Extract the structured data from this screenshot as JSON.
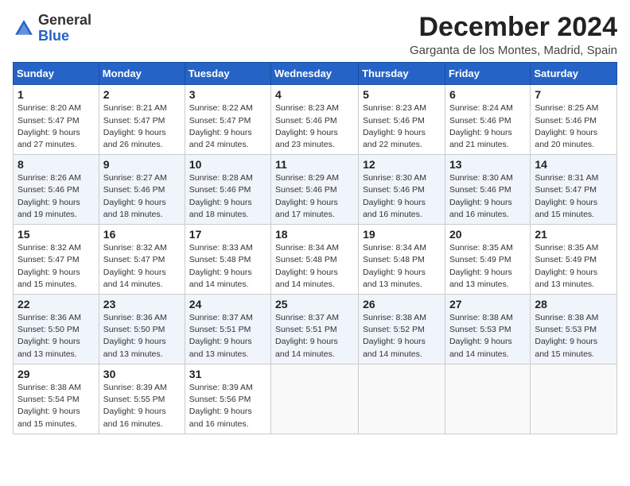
{
  "header": {
    "logo_general": "General",
    "logo_blue": "Blue",
    "month_title": "December 2024",
    "location": "Garganta de los Montes, Madrid, Spain"
  },
  "days_of_week": [
    "Sunday",
    "Monday",
    "Tuesday",
    "Wednesday",
    "Thursday",
    "Friday",
    "Saturday"
  ],
  "weeks": [
    [
      {
        "day": "1",
        "info": "Sunrise: 8:20 AM\nSunset: 5:47 PM\nDaylight: 9 hours and 27 minutes."
      },
      {
        "day": "2",
        "info": "Sunrise: 8:21 AM\nSunset: 5:47 PM\nDaylight: 9 hours and 26 minutes."
      },
      {
        "day": "3",
        "info": "Sunrise: 8:22 AM\nSunset: 5:47 PM\nDaylight: 9 hours and 24 minutes."
      },
      {
        "day": "4",
        "info": "Sunrise: 8:23 AM\nSunset: 5:46 PM\nDaylight: 9 hours and 23 minutes."
      },
      {
        "day": "5",
        "info": "Sunrise: 8:23 AM\nSunset: 5:46 PM\nDaylight: 9 hours and 22 minutes."
      },
      {
        "day": "6",
        "info": "Sunrise: 8:24 AM\nSunset: 5:46 PM\nDaylight: 9 hours and 21 minutes."
      },
      {
        "day": "7",
        "info": "Sunrise: 8:25 AM\nSunset: 5:46 PM\nDaylight: 9 hours and 20 minutes."
      }
    ],
    [
      {
        "day": "8",
        "info": "Sunrise: 8:26 AM\nSunset: 5:46 PM\nDaylight: 9 hours and 19 minutes."
      },
      {
        "day": "9",
        "info": "Sunrise: 8:27 AM\nSunset: 5:46 PM\nDaylight: 9 hours and 18 minutes."
      },
      {
        "day": "10",
        "info": "Sunrise: 8:28 AM\nSunset: 5:46 PM\nDaylight: 9 hours and 18 minutes."
      },
      {
        "day": "11",
        "info": "Sunrise: 8:29 AM\nSunset: 5:46 PM\nDaylight: 9 hours and 17 minutes."
      },
      {
        "day": "12",
        "info": "Sunrise: 8:30 AM\nSunset: 5:46 PM\nDaylight: 9 hours and 16 minutes."
      },
      {
        "day": "13",
        "info": "Sunrise: 8:30 AM\nSunset: 5:46 PM\nDaylight: 9 hours and 16 minutes."
      },
      {
        "day": "14",
        "info": "Sunrise: 8:31 AM\nSunset: 5:47 PM\nDaylight: 9 hours and 15 minutes."
      }
    ],
    [
      {
        "day": "15",
        "info": "Sunrise: 8:32 AM\nSunset: 5:47 PM\nDaylight: 9 hours and 15 minutes."
      },
      {
        "day": "16",
        "info": "Sunrise: 8:32 AM\nSunset: 5:47 PM\nDaylight: 9 hours and 14 minutes."
      },
      {
        "day": "17",
        "info": "Sunrise: 8:33 AM\nSunset: 5:48 PM\nDaylight: 9 hours and 14 minutes."
      },
      {
        "day": "18",
        "info": "Sunrise: 8:34 AM\nSunset: 5:48 PM\nDaylight: 9 hours and 14 minutes."
      },
      {
        "day": "19",
        "info": "Sunrise: 8:34 AM\nSunset: 5:48 PM\nDaylight: 9 hours and 13 minutes."
      },
      {
        "day": "20",
        "info": "Sunrise: 8:35 AM\nSunset: 5:49 PM\nDaylight: 9 hours and 13 minutes."
      },
      {
        "day": "21",
        "info": "Sunrise: 8:35 AM\nSunset: 5:49 PM\nDaylight: 9 hours and 13 minutes."
      }
    ],
    [
      {
        "day": "22",
        "info": "Sunrise: 8:36 AM\nSunset: 5:50 PM\nDaylight: 9 hours and 13 minutes."
      },
      {
        "day": "23",
        "info": "Sunrise: 8:36 AM\nSunset: 5:50 PM\nDaylight: 9 hours and 13 minutes."
      },
      {
        "day": "24",
        "info": "Sunrise: 8:37 AM\nSunset: 5:51 PM\nDaylight: 9 hours and 13 minutes."
      },
      {
        "day": "25",
        "info": "Sunrise: 8:37 AM\nSunset: 5:51 PM\nDaylight: 9 hours and 14 minutes."
      },
      {
        "day": "26",
        "info": "Sunrise: 8:38 AM\nSunset: 5:52 PM\nDaylight: 9 hours and 14 minutes."
      },
      {
        "day": "27",
        "info": "Sunrise: 8:38 AM\nSunset: 5:53 PM\nDaylight: 9 hours and 14 minutes."
      },
      {
        "day": "28",
        "info": "Sunrise: 8:38 AM\nSunset: 5:53 PM\nDaylight: 9 hours and 15 minutes."
      }
    ],
    [
      {
        "day": "29",
        "info": "Sunrise: 8:38 AM\nSunset: 5:54 PM\nDaylight: 9 hours and 15 minutes."
      },
      {
        "day": "30",
        "info": "Sunrise: 8:39 AM\nSunset: 5:55 PM\nDaylight: 9 hours and 16 minutes."
      },
      {
        "day": "31",
        "info": "Sunrise: 8:39 AM\nSunset: 5:56 PM\nDaylight: 9 hours and 16 minutes."
      },
      null,
      null,
      null,
      null
    ]
  ]
}
